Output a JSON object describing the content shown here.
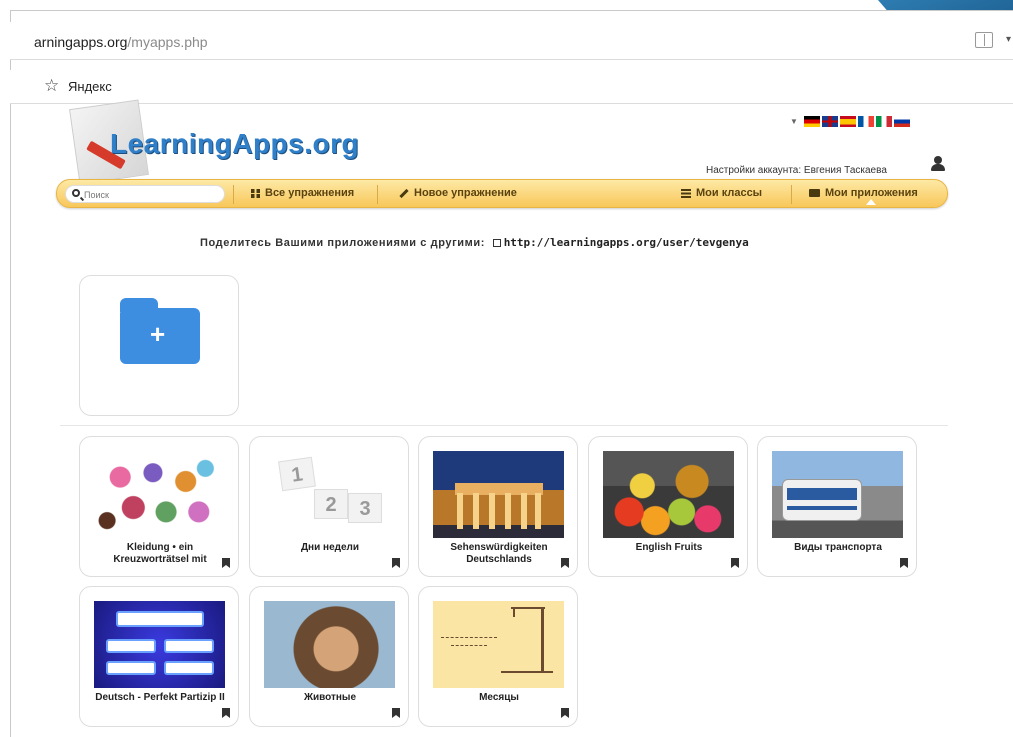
{
  "browser": {
    "address_host": "arningapps.org",
    "address_path": "/myapps.php",
    "bookmark_label": "Яндекс"
  },
  "site": {
    "logo": "LearningApps.org",
    "account_text": "Настройки аккаунта: Евгения Таскаева",
    "languages": [
      "de",
      "gb",
      "es",
      "fr",
      "it",
      "ru"
    ]
  },
  "nav": {
    "search_placeholder": "Поиск",
    "all_exercises": "Все упражнения",
    "new_exercise": "Новое упражнение",
    "my_classes": "Мои классы",
    "my_apps": "Мои приложения"
  },
  "share": {
    "text": "Поделитесь Вашими приложениями с другими:",
    "url": "http://learningapps.org/user/tevgenya"
  },
  "apps": [
    {
      "title": "Kleidung • ein Kreuzworträtsel mit"
    },
    {
      "title": "Дни недели"
    },
    {
      "title": "Sehenswürdigkeiten Deutschlands"
    },
    {
      "title": "English Fruits"
    },
    {
      "title": "Виды транспорта"
    },
    {
      "title": "Deutsch - Perfekt Partizip II"
    },
    {
      "title": "Животные"
    },
    {
      "title": "Месяцы"
    }
  ],
  "days_numbers": [
    "1",
    "2",
    "3"
  ]
}
